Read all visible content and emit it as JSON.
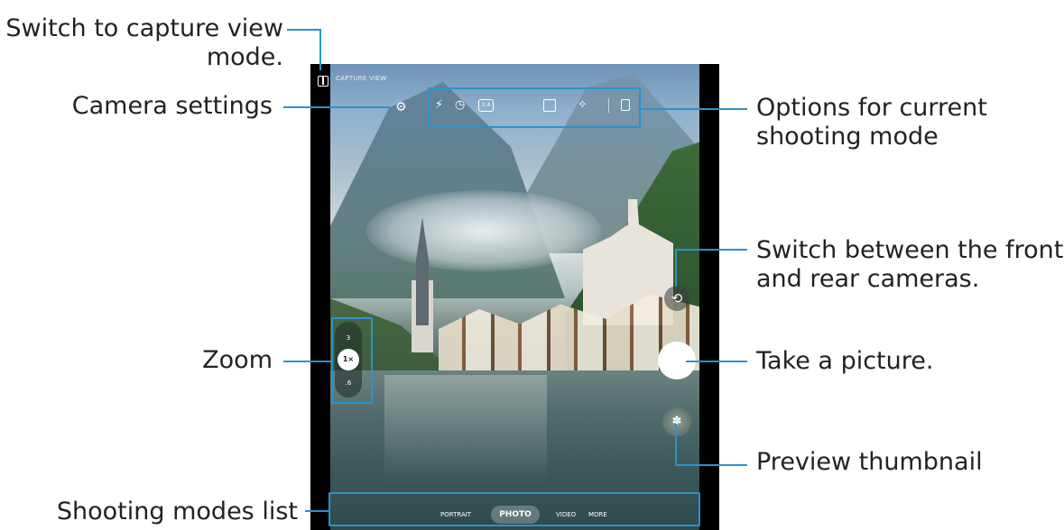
{
  "callouts": {
    "capture_view_line1": "Switch to capture view",
    "capture_view_line2": "mode.",
    "camera_settings": "Camera settings",
    "zoom": "Zoom",
    "shooting_modes_list": "Shooting modes list",
    "options_line1": "Options for current",
    "options_line2": "shooting mode",
    "switch_cameras_line1": "Switch between the front",
    "switch_cameras_line2": "and rear cameras.",
    "take_picture": "Take a picture.",
    "preview_thumbnail": "Preview thumbnail"
  },
  "camera_ui": {
    "capture_view_label": "CAPTURE VIEW",
    "ratio_label": "3:4",
    "zoom_levels": [
      "3",
      "1×",
      ".6"
    ],
    "modes": {
      "portrait": "PORTRAIT",
      "photo": "PHOTO",
      "video": "VIDEO",
      "more": "MORE"
    }
  },
  "colors": {
    "callout_line": "#2a93cc",
    "text": "#222222"
  },
  "icons": {
    "capture_view": "capture-view-icon",
    "settings": "gear-icon",
    "flash": "flash-off-icon",
    "timer": "timer-icon",
    "ratio": "aspect-ratio-icon",
    "motion": "motion-photo-icon",
    "effects": "effects-icon",
    "switch": "switch-camera-icon",
    "thumbnail": "preview-thumbnail-icon"
  }
}
